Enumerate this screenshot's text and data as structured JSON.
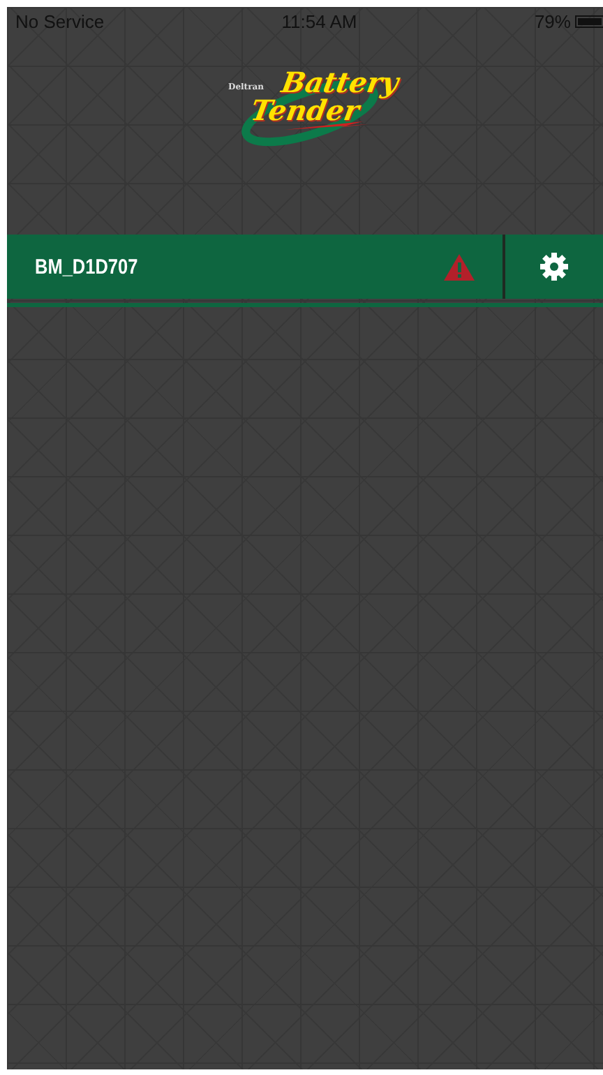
{
  "status_bar": {
    "carrier": "No Service",
    "time": "11:54 AM",
    "battery": "79%"
  },
  "logo": {
    "maker": "Deltran",
    "line_1": "Battery",
    "line_2": "Tender"
  },
  "devices": [
    {
      "name": "BM_D1D707",
      "alert": true,
      "selected": false
    }
  ]
}
